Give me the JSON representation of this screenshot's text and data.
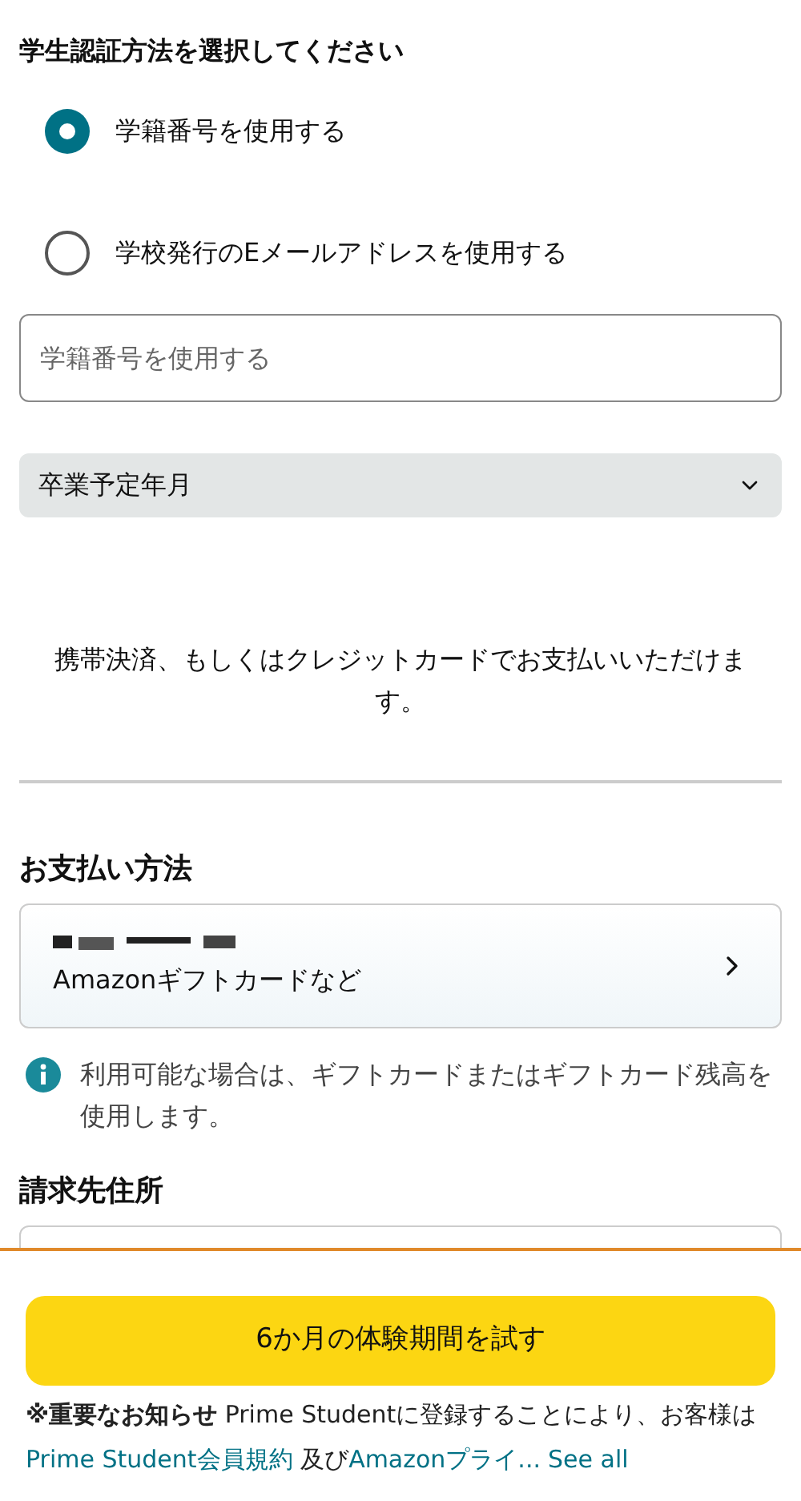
{
  "verification": {
    "title": "学生認証方法を選択してください",
    "options": [
      {
        "label": "学籍番号を使用する",
        "selected": true
      },
      {
        "label": "学校発行のEメールアドレスを使用する",
        "selected": false
      }
    ],
    "id_field": {
      "placeholder": "学籍番号を使用する"
    },
    "graduation_select": {
      "value": "卒業予定年月"
    }
  },
  "payment_note": "携帯決済、もしくはクレジットカードでお支払いいただけます。",
  "payment": {
    "title": "お支払い方法",
    "method": "Amazonギフトカードなど",
    "info": "利用可能な場合は、ギフトカードまたはギフトカード残高を使用します。"
  },
  "billing": {
    "title": "請求先住所"
  },
  "footer": {
    "button": "6か月の体験期間を試す",
    "notice": [
      {
        "kind": "text",
        "text": "**※重要なお知らせ** Prime Studentに登録することにより、お客様は "
      },
      {
        "kind": "link",
        "text": "Prime Student会員規約"
      },
      {
        "kind": "text",
        "text": " 及び"
      },
      {
        "kind": "link",
        "text": "Amazonプライ..."
      },
      {
        "kind": "link",
        "text": "See all"
      }
    ]
  }
}
